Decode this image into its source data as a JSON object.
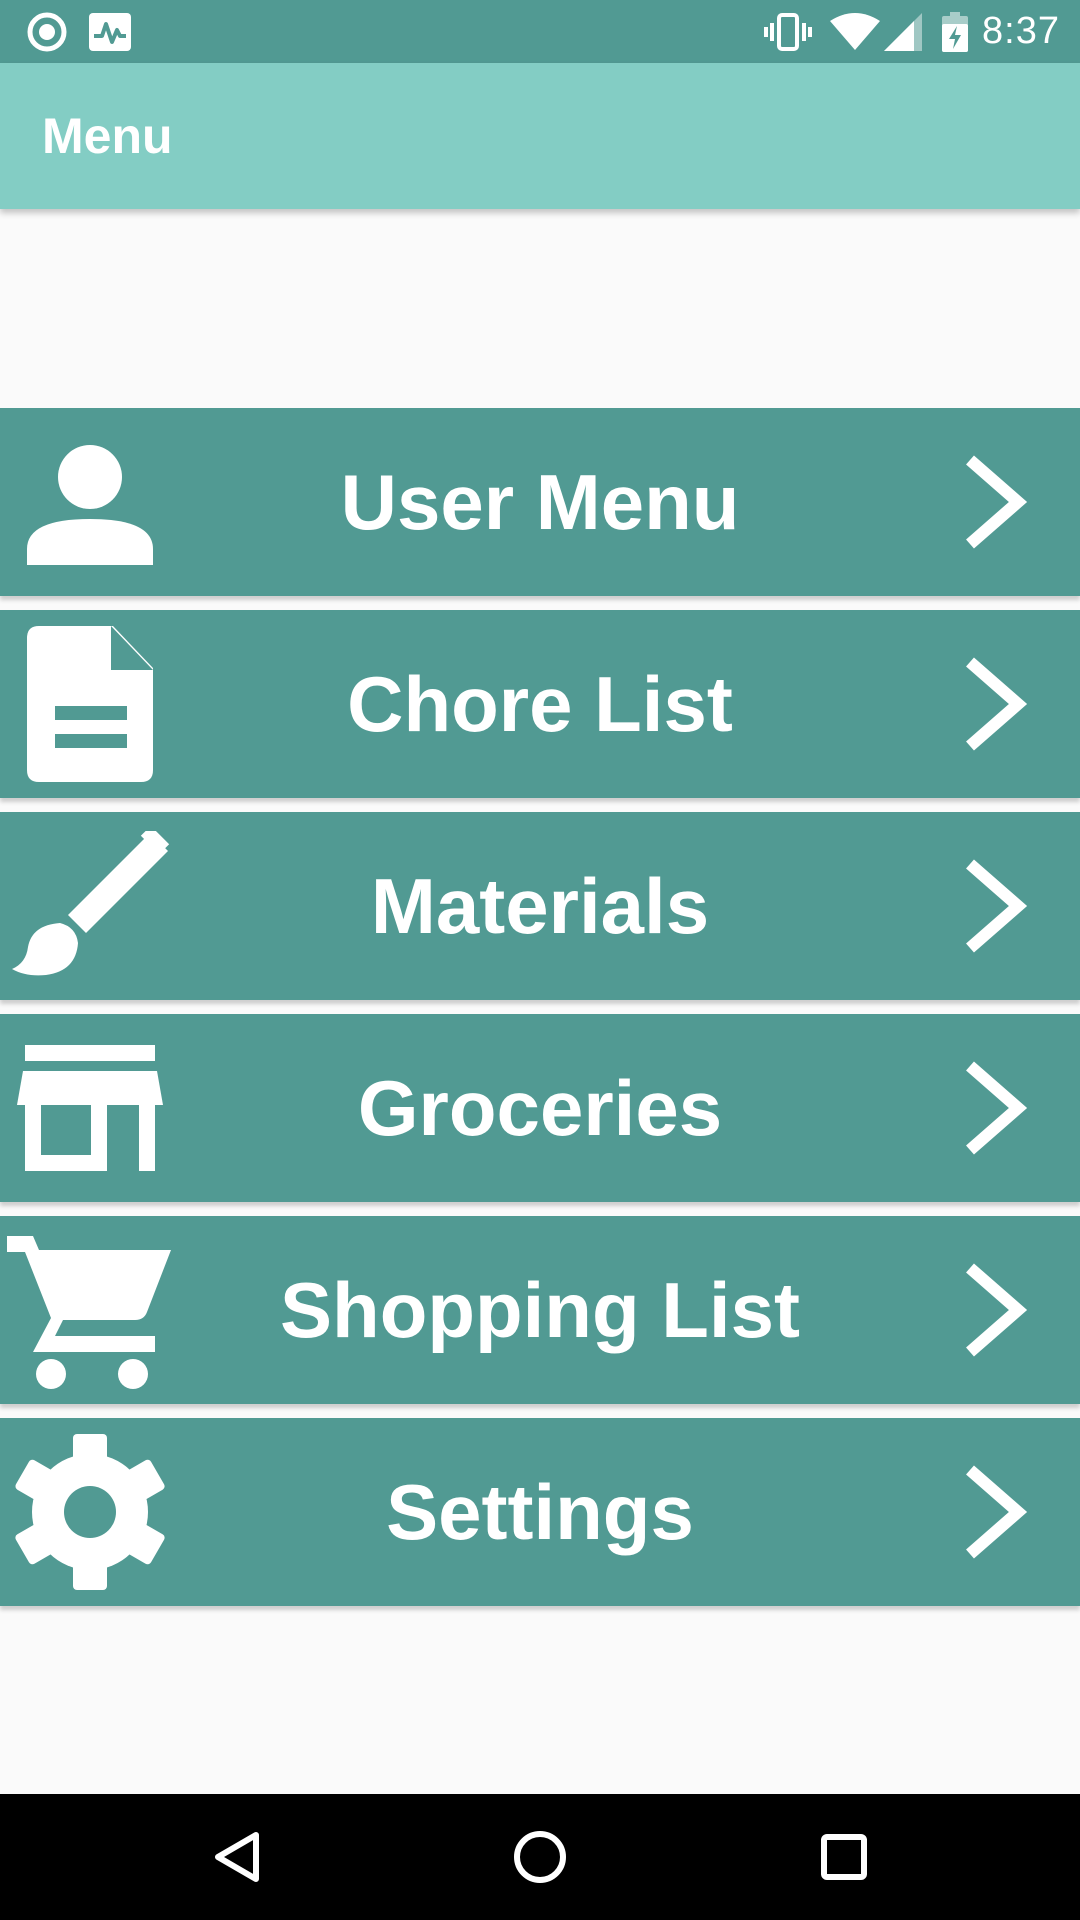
{
  "status_bar": {
    "time": "8:37",
    "left_icons": [
      "circle-notification-icon",
      "activity-monitor-icon"
    ],
    "right_icons": [
      "vibrate-icon",
      "wifi-icon",
      "cell-signal-icon",
      "battery-charging-icon"
    ]
  },
  "app_bar": {
    "title": "Menu"
  },
  "menu": {
    "items": [
      {
        "label": "User Menu",
        "icon": "person-icon"
      },
      {
        "label": "Chore List",
        "icon": "document-icon"
      },
      {
        "label": "Materials",
        "icon": "brush-icon"
      },
      {
        "label": "Groceries",
        "icon": "store-icon"
      },
      {
        "label": "Shopping List",
        "icon": "cart-icon"
      },
      {
        "label": "Settings",
        "icon": "gear-icon"
      }
    ]
  },
  "nav_bar": {
    "buttons": [
      "back-icon",
      "home-icon",
      "recents-icon"
    ]
  },
  "colors": {
    "status_bar": "#519a93",
    "app_bar": "#83cdc4",
    "menu_item": "#519a93",
    "background": "#fafafa",
    "nav_bar": "#000000",
    "text": "#ffffff"
  }
}
